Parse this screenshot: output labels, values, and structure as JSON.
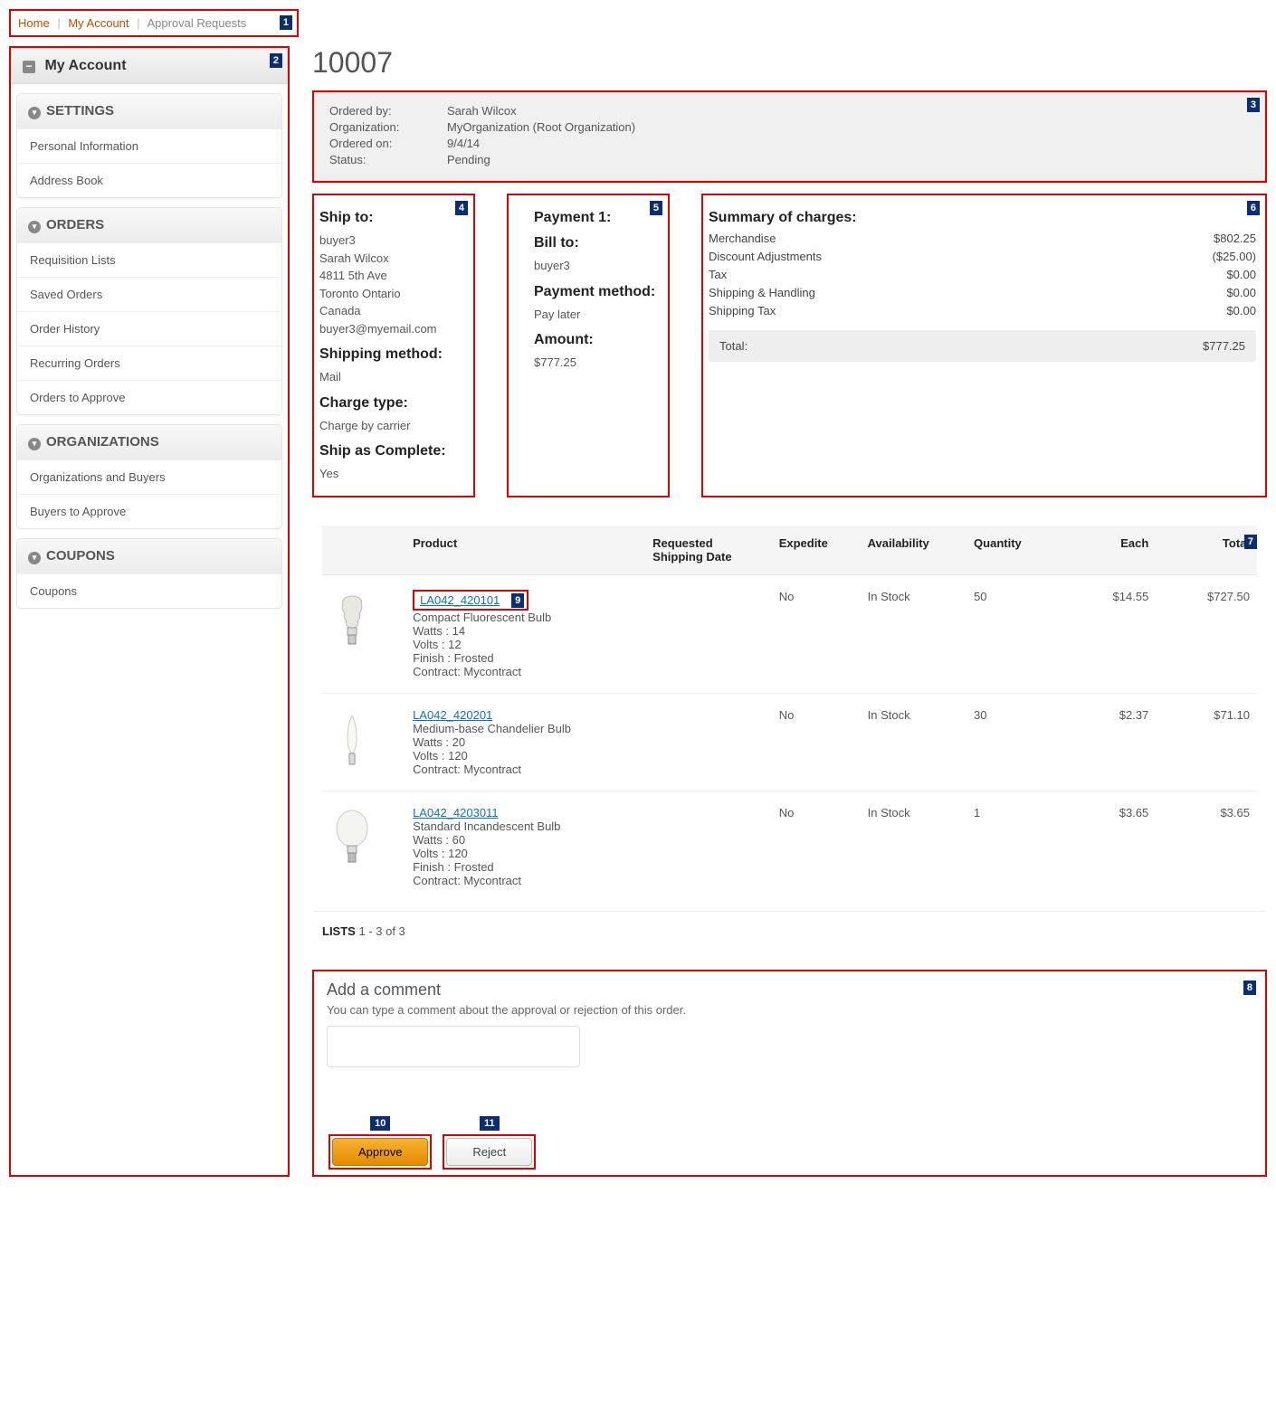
{
  "breadcrumb": {
    "home": "Home",
    "account": "My Account",
    "current": "Approval Requests"
  },
  "sidebar": {
    "title": "My Account",
    "groups": [
      {
        "head": "SETTINGS",
        "items": [
          "Personal Information",
          "Address Book"
        ]
      },
      {
        "head": "ORDERS",
        "items": [
          "Requisition Lists",
          "Saved Orders",
          "Order History",
          "Recurring Orders",
          "Orders to Approve"
        ]
      },
      {
        "head": "ORGANIZATIONS",
        "items": [
          "Organizations and Buyers",
          "Buyers to Approve"
        ]
      },
      {
        "head": "COUPONS",
        "items": [
          "Coupons"
        ]
      }
    ]
  },
  "order": {
    "number": "10007",
    "meta": {
      "orderedByLabel": "Ordered by:",
      "orderedBy": "Sarah Wilcox",
      "orgLabel": "Organization:",
      "org": "MyOrganization (Root Organization)",
      "orderedOnLabel": "Ordered on:",
      "orderedOn": "9/4/14",
      "statusLabel": "Status:",
      "status": "Pending"
    },
    "ship": {
      "title": "Ship to:",
      "lines": [
        "buyer3",
        "Sarah Wilcox",
        "4811 5th Ave",
        "Toronto Ontario",
        "Canada",
        "buyer3@myemail.com"
      ],
      "methodTitle": "Shipping method:",
      "method": "Mail",
      "chargeTitle": "Charge type:",
      "charge": "Charge by carrier",
      "shipCompleteTitle": "Ship as Complete:",
      "shipComplete": "Yes"
    },
    "payment": {
      "title": "Payment 1:",
      "billTitle": "Bill to:",
      "bill": "buyer3",
      "methodTitle": "Payment method:",
      "method": "Pay later",
      "amountTitle": "Amount:",
      "amount": "$777.25"
    },
    "summary": {
      "title": "Summary of charges:",
      "rows": [
        {
          "k": "Merchandise",
          "v": "$802.25"
        },
        {
          "k": "Discount Adjustments",
          "v": "($25.00)"
        },
        {
          "k": "Tax",
          "v": "$0.00"
        },
        {
          "k": "Shipping & Handling",
          "v": "$0.00"
        },
        {
          "k": "Shipping Tax",
          "v": "$0.00"
        }
      ],
      "totalLabel": "Total:",
      "total": "$777.25"
    },
    "items": {
      "headers": {
        "product": "Product",
        "reqDate": "Requested Shipping Date",
        "expedite": "Expedite",
        "avail": "Availability",
        "qty": "Quantity",
        "each": "Each",
        "total": "Total"
      },
      "rows": [
        {
          "sku": "LA042_420101",
          "name": "Compact Fluorescent Bulb",
          "attrs": [
            "Watts : 14",
            "Volts : 12",
            "Finish : Frosted",
            "Contract: Mycontract"
          ],
          "reqDate": "",
          "expedite": "No",
          "avail": "In Stock",
          "qty": "50",
          "each": "$14.55",
          "total": "$727.50"
        },
        {
          "sku": "LA042_420201",
          "name": "Medium-base Chandelier Bulb",
          "attrs": [
            "Watts : 20",
            "Volts : 120",
            "Contract: Mycontract"
          ],
          "reqDate": "",
          "expedite": "No",
          "avail": "In Stock",
          "qty": "30",
          "each": "$2.37",
          "total": "$71.10"
        },
        {
          "sku": "LA042_4203011",
          "name": "Standard Incandescent Bulb",
          "attrs": [
            "Watts : 60",
            "Volts : 120",
            "Finish : Frosted",
            "Contract: Mycontract"
          ],
          "reqDate": "",
          "expedite": "No",
          "avail": "In Stock",
          "qty": "1",
          "each": "$3.65",
          "total": "$3.65"
        }
      ],
      "listsLabel": "LISTS",
      "listsRange": "1 - 3 of 3"
    },
    "comment": {
      "title": "Add a comment",
      "hint": "You can type a comment about the approval or rejection of this order.",
      "placeholder": ""
    },
    "actions": {
      "approve": "Approve",
      "reject": "Reject"
    }
  },
  "callouts": {
    "c1": "1",
    "c2": "2",
    "c3": "3",
    "c4": "4",
    "c5": "5",
    "c6": "6",
    "c7": "7",
    "c8": "8",
    "c9": "9",
    "c10": "10",
    "c11": "11"
  }
}
